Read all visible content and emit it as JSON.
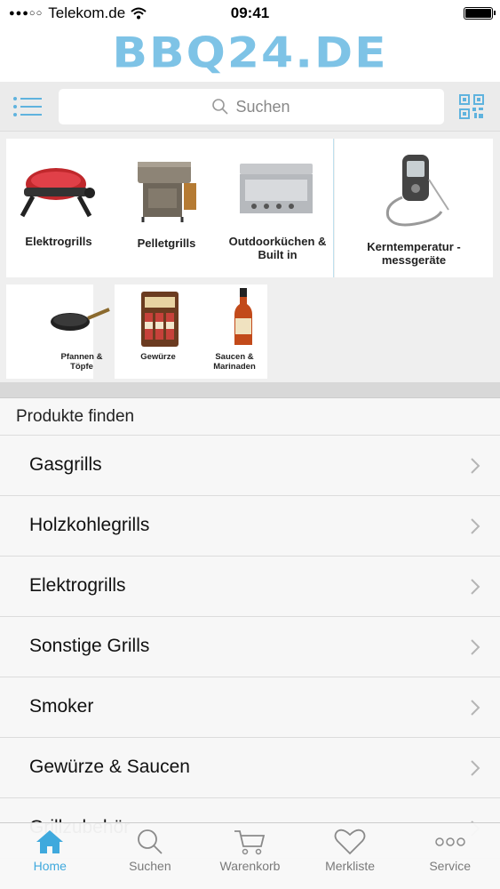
{
  "status_bar": {
    "signal": "●●●○○",
    "carrier": "Telekom.de",
    "time": "09:41"
  },
  "logo": {
    "text": "BBQ24.DE",
    "color": "#7ec3e6"
  },
  "search": {
    "placeholder": "Suchen"
  },
  "categories": [
    {
      "label": "Elektrogrills"
    },
    {
      "label": "Pelletgrills"
    },
    {
      "label": "Outdoorküchen & Built in"
    },
    {
      "label": "Kerntemperatur - messgeräte"
    },
    {
      "label": "Pfannen & Töpfe"
    },
    {
      "label": "Gewürze"
    },
    {
      "label": "Saucen & Marinaden"
    }
  ],
  "section": {
    "title": "Produkte finden"
  },
  "list": [
    {
      "label": "Gasgrills"
    },
    {
      "label": "Holzkohlegrills"
    },
    {
      "label": "Elektrogrills"
    },
    {
      "label": "Sonstige Grills"
    },
    {
      "label": "Smoker"
    },
    {
      "label": "Gewürze & Saucen"
    },
    {
      "label": "Grillzubehör"
    }
  ],
  "tabs": [
    {
      "label": "Home",
      "icon": "home-icon",
      "active": true
    },
    {
      "label": "Suchen",
      "icon": "search-icon",
      "active": false
    },
    {
      "label": "Warenkorb",
      "icon": "cart-icon",
      "active": false
    },
    {
      "label": "Merkliste",
      "icon": "heart-icon",
      "active": false
    },
    {
      "label": "Service",
      "icon": "more-icon",
      "active": false
    }
  ],
  "colors": {
    "accent": "#3fa9dd",
    "logo": "#7ec3e6"
  }
}
